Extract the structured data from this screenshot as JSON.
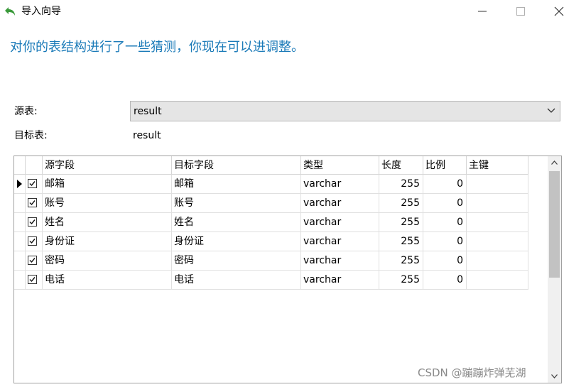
{
  "window": {
    "title": "导入向导",
    "icon": "back-arrow-icon",
    "controls": [
      "minimize-icon",
      "maximize-icon",
      "close-icon"
    ]
  },
  "heading": "对你的表结构进行了一些猜测，你现在可以进调整。",
  "source_table": {
    "label": "源表:",
    "value": "result"
  },
  "target_table": {
    "label": "目标表:",
    "value": "result"
  },
  "grid": {
    "columns": [
      "源字段",
      "目标字段",
      "类型",
      "长度",
      "比例",
      "主键"
    ],
    "rows": [
      {
        "checked": true,
        "source": "邮箱",
        "target": "邮箱",
        "type": "varchar",
        "length": "255",
        "scale": "0",
        "key": ""
      },
      {
        "checked": true,
        "source": "账号",
        "target": "账号",
        "type": "varchar",
        "length": "255",
        "scale": "0",
        "key": ""
      },
      {
        "checked": true,
        "source": "姓名",
        "target": "姓名",
        "type": "varchar",
        "length": "255",
        "scale": "0",
        "key": ""
      },
      {
        "checked": true,
        "source": "身份证",
        "target": "身份证",
        "type": "varchar",
        "length": "255",
        "scale": "0",
        "key": ""
      },
      {
        "checked": true,
        "source": "密码",
        "target": "密码",
        "type": "varchar",
        "length": "255",
        "scale": "0",
        "key": ""
      },
      {
        "checked": true,
        "source": "电话",
        "target": "电话",
        "type": "varchar",
        "length": "255",
        "scale": "0",
        "key": ""
      }
    ]
  },
  "watermark": "CSDN @蹦蹦炸弹芜湖",
  "colors": {
    "heading": "#1a7ab8",
    "select_bg": "#e5e5e5",
    "scroll_thumb": "#c2c2c2"
  }
}
